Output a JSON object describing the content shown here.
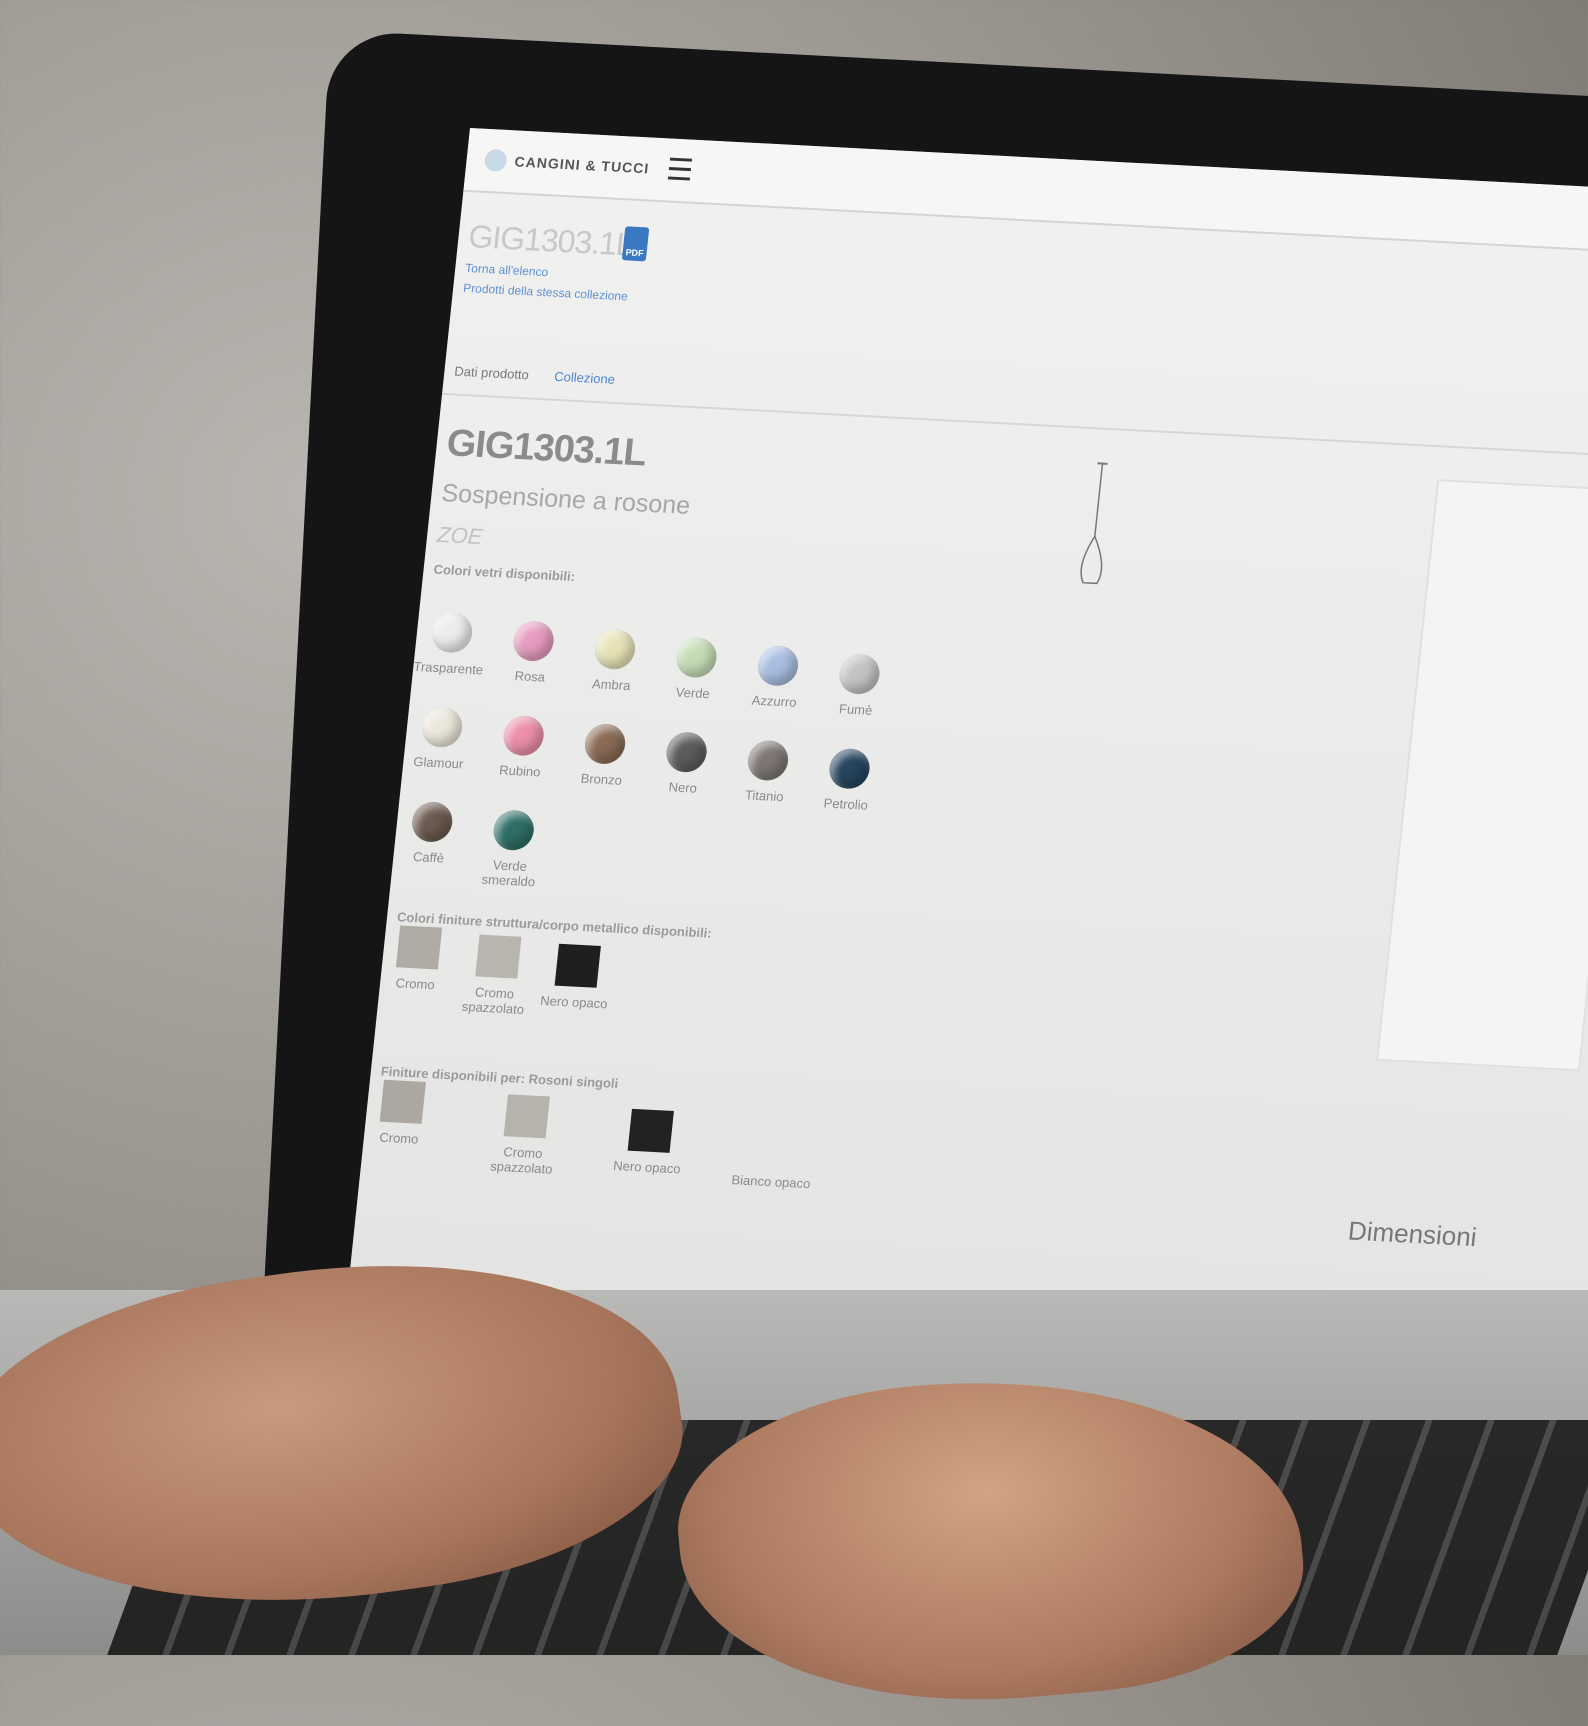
{
  "header": {
    "logo_text": "CANGINI & TUCCI",
    "menu_icon": "hamburger-icon"
  },
  "product_head": {
    "code": "GIG1303.1L",
    "pdf_icon_label": "PDF",
    "links": [
      "Torna all'elenco",
      "Prodotti della stessa collezione"
    ]
  },
  "tabs": [
    "Dati prodotto",
    "Collezione"
  ],
  "product": {
    "title": "GIG1303.1L",
    "subtitle": "Sospensione a rosone",
    "collection": "ZOE",
    "glass_colors_label": "Colori vetri disponibili:",
    "glass_colors": [
      {
        "label": "Trasparente",
        "color": "#ececec"
      },
      {
        "label": "Rosa",
        "color": "#e79bc0"
      },
      {
        "label": "Ambra",
        "color": "#e7e3b7"
      },
      {
        "label": "Verde",
        "color": "#c3dcb6"
      },
      {
        "label": "Azzurro",
        "color": "#a8bde1"
      },
      {
        "label": "Fumè",
        "color": "#c3c3c3"
      },
      {
        "label": "Glamour",
        "color": "#ece7db"
      },
      {
        "label": "Rubino",
        "color": "#ec8fa8"
      },
      {
        "label": "Bronzo",
        "color": "#8a6a55"
      },
      {
        "label": "Nero",
        "color": "#5c5c5c"
      },
      {
        "label": "Titanio",
        "color": "#7d7672"
      },
      {
        "label": "Petrolio",
        "color": "#26445e"
      },
      {
        "label": "Caffè",
        "color": "#6b5a4f"
      },
      {
        "label": "Verde smeraldo",
        "color": "#2e6e66"
      }
    ],
    "finish_label": "Colori finiture struttura/corpo metallico disponibili:",
    "finishes": [
      {
        "label": "Cromo",
        "color": "#b0aaa4"
      },
      {
        "label": "Cromo spazzolato",
        "color": "#b8b4ae"
      },
      {
        "label": "Nero opaco",
        "color": "#1f1f1f"
      }
    ],
    "rosone_label": "Finiture disponibili per: Rosoni singoli",
    "rosone_finishes": [
      {
        "label": "Cromo",
        "color": "#aca7a1"
      },
      {
        "label": "Cromo spazzolato",
        "color": "#b6b2ac"
      },
      {
        "label": "Nero opaco",
        "color": "#222222"
      },
      {
        "label": "Bianco opaco",
        "color": "#e6e6e4"
      }
    ],
    "dimensions_label": "Dimensioni"
  }
}
